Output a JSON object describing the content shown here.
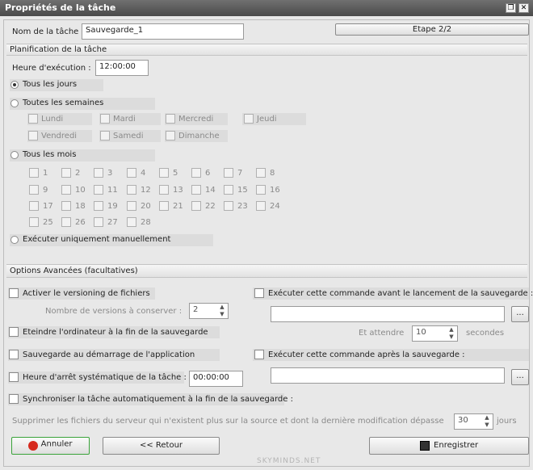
{
  "window": {
    "title": "Propriétés de la tâche"
  },
  "task": {
    "name_label": "Nom de la tâche :",
    "name_value": "Sauvegarde_1",
    "step_label": "Etape 2/2"
  },
  "planning": {
    "section": "Planification de la tâche",
    "time_label": "Heure d'exécution :",
    "time_value": "12:00:00",
    "daily": "Tous les jours",
    "weekly": "Toutes les semaines",
    "days": [
      "Lundi",
      "Mardi",
      "Mercredi",
      "Jeudi",
      "Vendredi",
      "Samedi",
      "Dimanche"
    ],
    "monthly": "Tous les mois",
    "month_days": [
      "1",
      "2",
      "3",
      "4",
      "5",
      "6",
      "7",
      "8",
      "9",
      "10",
      "11",
      "12",
      "13",
      "14",
      "15",
      "16",
      "17",
      "18",
      "19",
      "20",
      "21",
      "22",
      "23",
      "24",
      "25",
      "26",
      "27",
      "28"
    ],
    "manual": "Exécuter uniquement manuellement"
  },
  "advanced": {
    "section": "Options Avancées (facultatives)",
    "versioning": "Activer le versioning de fichiers",
    "versions_label": "Nombre de versions à conserver :",
    "versions_value": "2",
    "shutdown": "Eteindre l'ordinateur à la fin de la sauvegarde",
    "startup": "Sauvegarde au démarrage de l'application",
    "stop_time": "Heure d'arrêt systématique de la tâche  :",
    "stop_time_value": "00:00:00",
    "sync": "Synchroniser la tâche automatiquement à la fin de la sauvegarde :",
    "delete_label": "Supprimer les fichiers du serveur qui n'existent plus sur la source et dont la dernière modification dépasse",
    "delete_value": "30",
    "delete_unit": "jours",
    "cmd_before": "Exécuter cette commande avant le lancement de la sauvegarde :",
    "wait_label": "Et attendre",
    "wait_value": "10",
    "wait_unit": "secondes",
    "cmd_after": "Exécuter cette commande après la sauvegarde :",
    "browse": "..."
  },
  "footer": {
    "cancel": "Annuler",
    "back": "<< Retour",
    "save": "Enregistrer",
    "watermark": "SKYMINDS.NET"
  }
}
